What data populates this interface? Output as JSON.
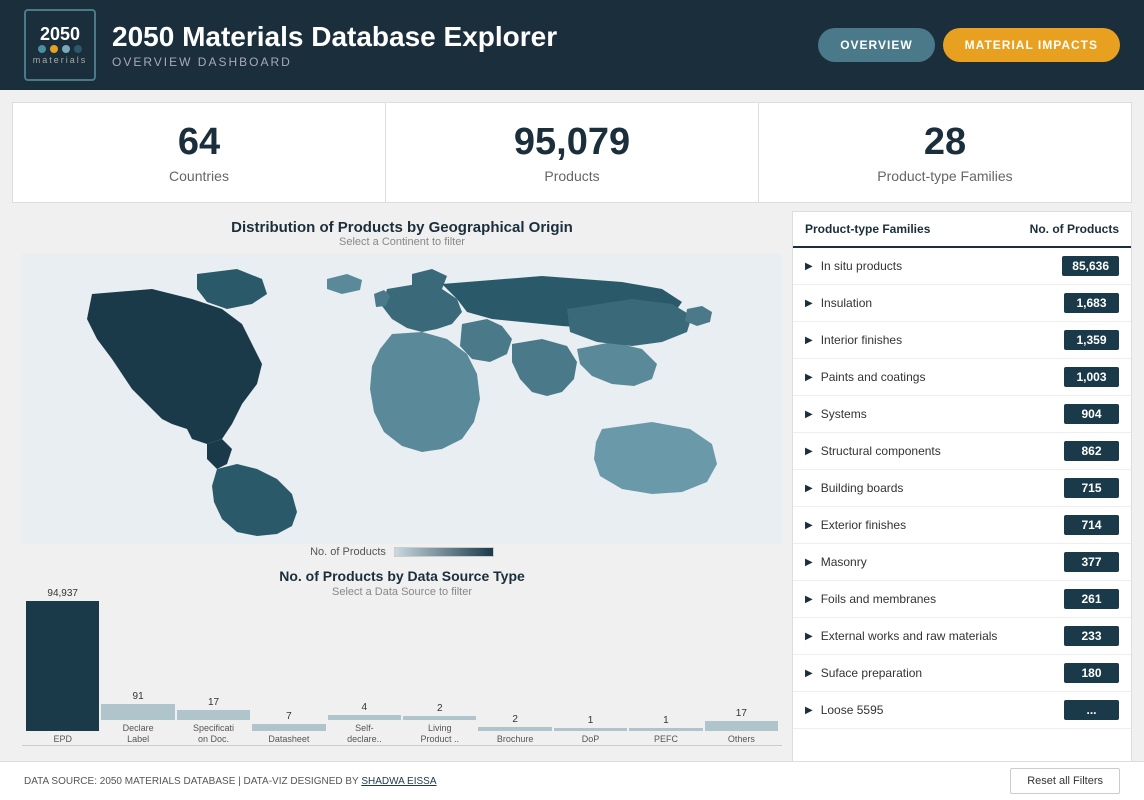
{
  "app": {
    "title": "2050 Materials Database Explorer",
    "subtitle": "OVERVIEW DASHBOARD",
    "logo_year": "2050",
    "logo_name": "materials"
  },
  "nav": {
    "overview_label": "OVERVIEW",
    "impacts_label": "MATERIAL IMPACTS"
  },
  "stats": [
    {
      "number": "64",
      "label": "Countries"
    },
    {
      "number": "95,079",
      "label": "Products"
    },
    {
      "number": "28",
      "label": "Product-type Families"
    }
  ],
  "map": {
    "title": "Distribution of Products by Geographical Origin",
    "subtitle": "Select a Continent to filter",
    "legend_label": "No. of Products"
  },
  "barchart": {
    "title": "No. of Products by Data Source Type",
    "subtitle": "Select a Data Source to filter",
    "bars": [
      {
        "label": "EPD",
        "value": 94937,
        "display": "94,937",
        "color": "#1a3a4a",
        "height": 130
      },
      {
        "label": "Declare\nLabel",
        "value": 91,
        "display": "91",
        "color": "#b0c4cc",
        "height": 16
      },
      {
        "label": "Specificati\non Doc.",
        "value": 17,
        "display": "17",
        "color": "#b0c4cc",
        "height": 10
      },
      {
        "label": "Datasheet",
        "value": 7,
        "display": "7",
        "color": "#b0c4cc",
        "height": 7
      },
      {
        "label": "Self-\ndeclare..",
        "value": 4,
        "display": "4",
        "color": "#b0c4cc",
        "height": 5
      },
      {
        "label": "Living\nProduct ..",
        "value": 2,
        "display": "2",
        "color": "#b0c4cc",
        "height": 4
      },
      {
        "label": "Brochure",
        "value": 2,
        "display": "2",
        "color": "#b0c4cc",
        "height": 4
      },
      {
        "label": "DoP",
        "value": 1,
        "display": "1",
        "color": "#b0c4cc",
        "height": 3
      },
      {
        "label": "PEFC",
        "value": 1,
        "display": "1",
        "color": "#b0c4cc",
        "height": 3
      },
      {
        "label": "Others",
        "value": 17,
        "display": "17",
        "color": "#b0c4cc",
        "height": 10
      }
    ]
  },
  "table": {
    "col_family": "Product-type Families",
    "col_products": "No. of Products",
    "rows": [
      {
        "name": "In situ products",
        "count": "85,636"
      },
      {
        "name": "Insulation",
        "count": "1,683"
      },
      {
        "name": "Interior finishes",
        "count": "1,359"
      },
      {
        "name": "Paints and coatings",
        "count": "1,003"
      },
      {
        "name": "Systems",
        "count": "904"
      },
      {
        "name": "Structural components",
        "count": "862"
      },
      {
        "name": "Building boards",
        "count": "715"
      },
      {
        "name": "Exterior finishes",
        "count": "714"
      },
      {
        "name": "Masonry",
        "count": "377"
      },
      {
        "name": "Foils and membranes",
        "count": "261"
      },
      {
        "name": "External works and raw materials",
        "count": "233"
      },
      {
        "name": "Suface preparation",
        "count": "180"
      },
      {
        "name": "Loose 5595",
        "count": "..."
      }
    ]
  },
  "footer": {
    "source_text": "DATA SOURCE: 2050 MATERIALS DATABASE   |   DATA-VIZ DESIGNED BY",
    "designer_link": "SHADWA EISSA",
    "reset_label": "Reset all Filters"
  }
}
